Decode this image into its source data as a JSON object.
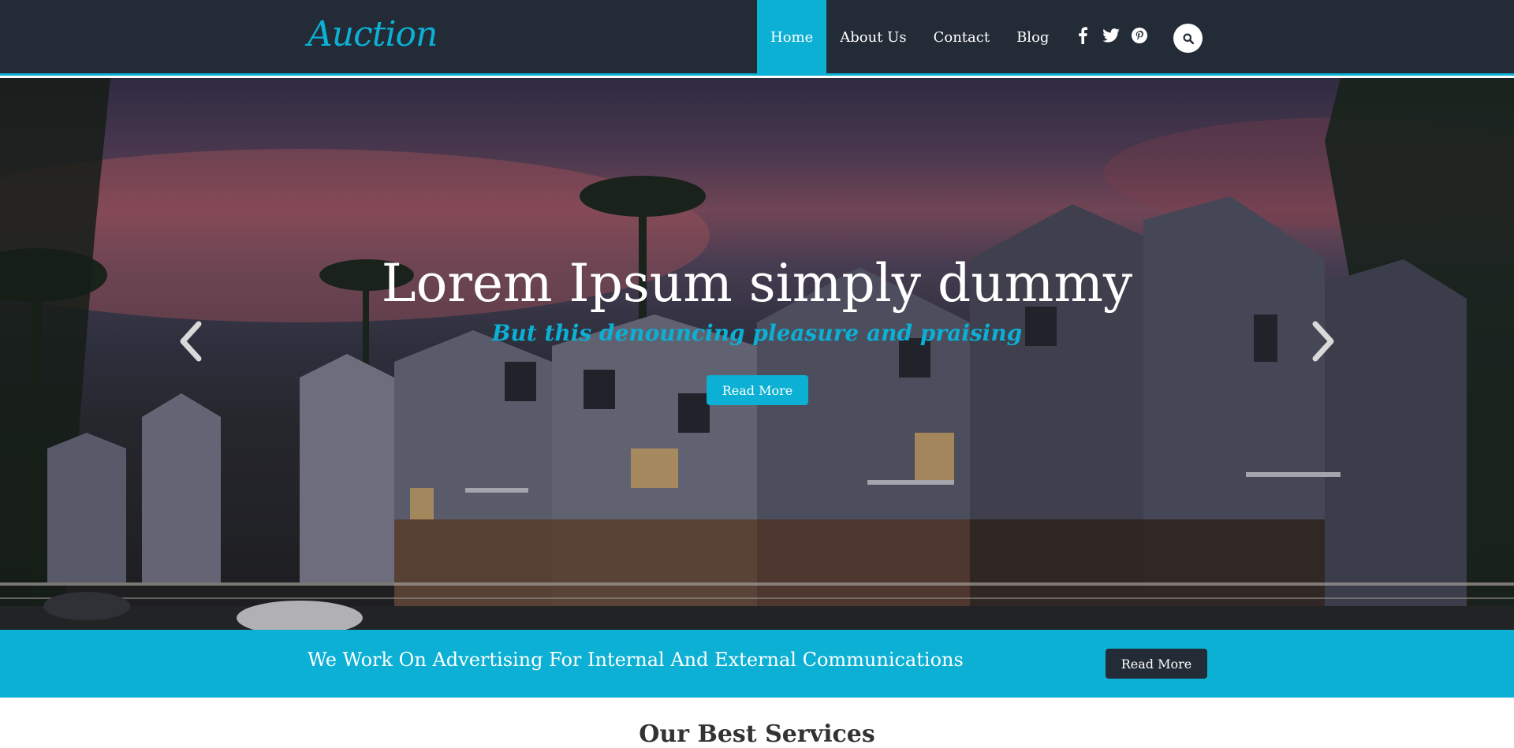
{
  "header": {
    "logo": "Auction",
    "nav": [
      {
        "label": "Home",
        "active": true
      },
      {
        "label": "About Us",
        "active": false
      },
      {
        "label": "Contact",
        "active": false
      },
      {
        "label": "Blog",
        "active": false
      }
    ],
    "social_icons": [
      "facebook-icon",
      "twitter-icon",
      "pinterest-icon"
    ],
    "search_icon": "search-icon"
  },
  "hero": {
    "title": "Lorem Ipsum simply dummy",
    "subtitle": "But this denouncing pleasure and praising",
    "button_label": "Read More"
  },
  "banner": {
    "text": "We Work On Advertising For Internal And External Communications",
    "button_label": "Read More"
  },
  "services": {
    "title": "Our Best Services"
  },
  "colors": {
    "accent": "#0bb0d4",
    "header_bg": "#232b37",
    "dark_button": "#232b37",
    "white": "#ffffff"
  }
}
